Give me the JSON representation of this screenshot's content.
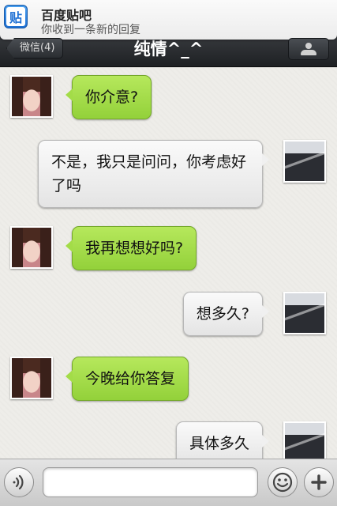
{
  "notification": {
    "app_icon": "tieba-app-icon",
    "icon_glyph": "贴",
    "title": "百度贴吧",
    "subtitle": "你收到一条新的回复"
  },
  "navbar": {
    "back_label": "微信(4)",
    "title": "纯情^_^",
    "right_icon": "contact-person-icon"
  },
  "messages": [
    {
      "from": "them",
      "text": "你介意?"
    },
    {
      "from": "me",
      "text": "不是，我只是问问，你考虑好了吗"
    },
    {
      "from": "them",
      "text": "我再想想好吗?"
    },
    {
      "from": "me",
      "text": "想多久?"
    },
    {
      "from": "them",
      "text": "今晚给你答复"
    },
    {
      "from": "me",
      "text": "具体多久"
    }
  ],
  "inputbar": {
    "voice_icon": "voice-icon",
    "text_value": "",
    "emoji_icon": "emoji-icon",
    "plus_icon": "plus-icon"
  },
  "colors": {
    "green_bubble": "#a3dc48",
    "white_bubble": "#f2f2f2",
    "navbar": "#2a2d31"
  }
}
